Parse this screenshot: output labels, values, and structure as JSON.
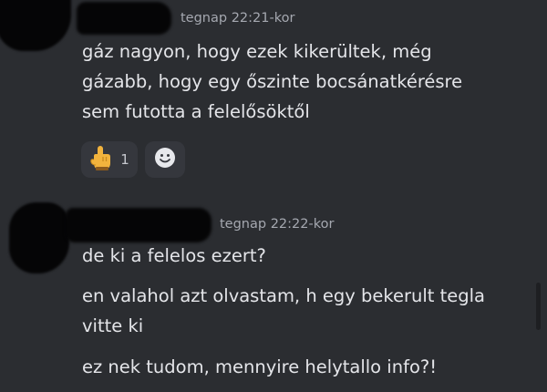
{
  "messages": [
    {
      "timestamp": "tegnap 22:21-kor",
      "lines": [
        "gáz nagyon, hogy ezek kikerültek, még",
        "gázabb, hogy egy őszinte bocsánatkérésre",
        "sem futotta a felelősöktől"
      ],
      "reactions": [
        {
          "icon": "pointing-hand-icon",
          "count": "1"
        }
      ],
      "add_reaction_icon": "smiley-icon"
    },
    {
      "timestamp": "tegnap 22:22-kor",
      "paragraphs": [
        "de ki a felelos ezert?",
        "en valahol azt olvastam, h egy bekerult tegla vitte ki",
        "ez nek tudom, mennyire helytallo info?!"
      ]
    }
  ],
  "colors": {
    "background": "#2b2d31",
    "text": "#e4e5e9",
    "timestamp": "#a5a8b0",
    "reaction_bg": "#35373d",
    "redaction": "#050506"
  }
}
